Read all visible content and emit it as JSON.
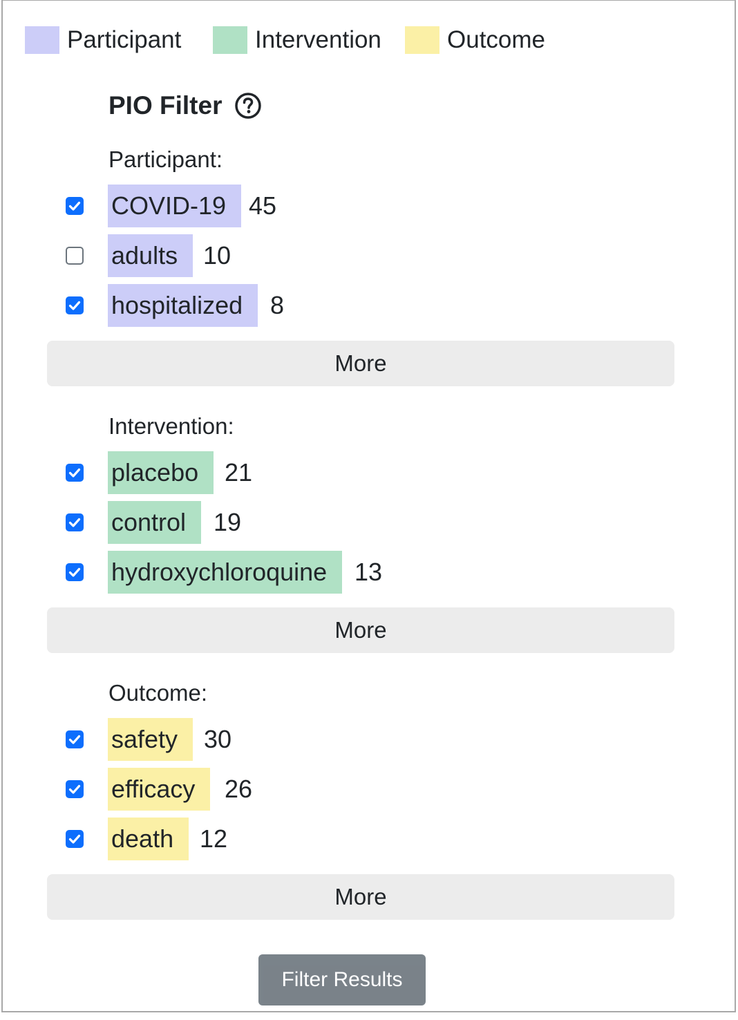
{
  "colors": {
    "participant": "#cccdf8",
    "intervention": "#b0e1c5",
    "outcome": "#fbf0a6",
    "checkbox_checked": "#0d6efd",
    "more_button_bg": "#ececec",
    "filter_button_bg": "#6c757d"
  },
  "legend": {
    "participant": "Participant",
    "intervention": "Intervention",
    "outcome": "Outcome"
  },
  "panel": {
    "title": "PIO Filter",
    "help_icon": "question-circle-icon"
  },
  "sections": {
    "participant": {
      "label": "Participant:",
      "items": [
        {
          "term": "COVID-19",
          "count": "45",
          "checked": true
        },
        {
          "term": "adults",
          "count": "10",
          "checked": false
        },
        {
          "term": "hospitalized",
          "count": "8",
          "checked": true
        }
      ],
      "more_label": "More"
    },
    "intervention": {
      "label": "Intervention:",
      "items": [
        {
          "term": "placebo",
          "count": "21",
          "checked": true
        },
        {
          "term": "control",
          "count": "19",
          "checked": true
        },
        {
          "term": "hydroxychloroquine",
          "count": "13",
          "checked": true
        }
      ],
      "more_label": "More"
    },
    "outcome": {
      "label": "Outcome:",
      "items": [
        {
          "term": "safety",
          "count": "30",
          "checked": true
        },
        {
          "term": "efficacy",
          "count": "26",
          "checked": true
        },
        {
          "term": "death",
          "count": "12",
          "checked": true
        }
      ],
      "more_label": "More"
    }
  },
  "filter_button": "Filter Results"
}
